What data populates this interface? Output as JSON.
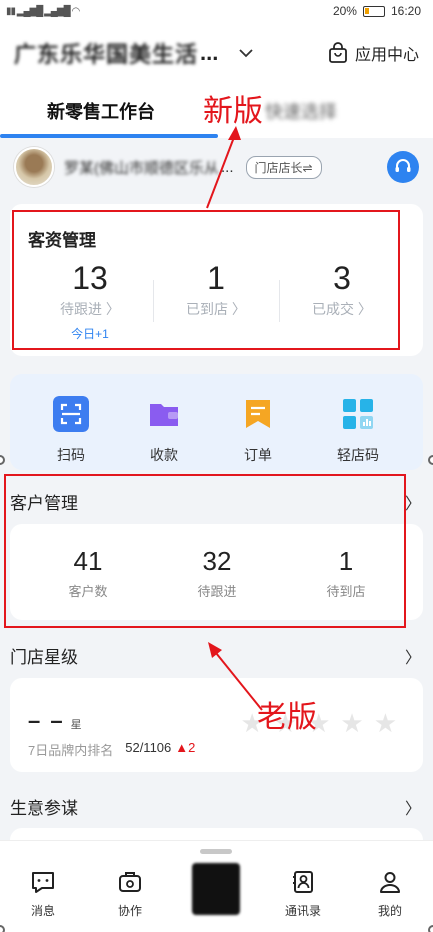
{
  "status_bar": {
    "battery": "20%",
    "time": "16:20"
  },
  "header": {
    "store_name": "广东乐华国美生活",
    "ellipsis": "...",
    "app_center": "应用中心"
  },
  "tabs": {
    "active": "新零售工作台",
    "other": "快速选择"
  },
  "user": {
    "name": "罗某(佛山市顺德区乐从",
    "ellipsis": "...",
    "role": "门店店长⇌"
  },
  "new_card": {
    "title": "客资管理",
    "stats": [
      {
        "value": "13",
        "label": "待跟进 〉",
        "sub": "今日+1"
      },
      {
        "value": "1",
        "label": "已到店 〉"
      },
      {
        "value": "3",
        "label": "已成交 〉"
      }
    ]
  },
  "quick_actions": [
    {
      "label": "扫码",
      "icon": "scan-icon",
      "color": "#3d7df0"
    },
    {
      "label": "收款",
      "icon": "wallet-icon",
      "color": "#8a5cf0"
    },
    {
      "label": "订单",
      "icon": "order-bookmark-icon",
      "color": "#f5a623"
    },
    {
      "label": "轻店码",
      "icon": "store-grid-icon",
      "color": "#27b3e8"
    }
  ],
  "old_section": {
    "title": "客户管理",
    "stats": [
      {
        "value": "41",
        "label": "客户数"
      },
      {
        "value": "32",
        "label": "待跟进"
      },
      {
        "value": "1",
        "label": "待到店"
      }
    ]
  },
  "store_level": {
    "title": "门店星级",
    "stars_value": "– –",
    "stars_unit": "星",
    "rank_label": "7日品牌内排名",
    "rank_value": "52/1106",
    "rank_change": "▲2",
    "star_rating": 0
  },
  "business": {
    "title": "生意参谋"
  },
  "annotations": {
    "new_version": "新版",
    "old_version": "老版"
  },
  "bottom_nav": [
    {
      "label": "消息",
      "icon": "message-icon"
    },
    {
      "label": "协作",
      "icon": "collaboration-icon"
    },
    {
      "label": "通讯录",
      "icon": "contacts-icon"
    },
    {
      "label": "我的",
      "icon": "profile-icon"
    }
  ],
  "colors": {
    "accent": "#2e83f0",
    "annotation": "#e3161c"
  }
}
